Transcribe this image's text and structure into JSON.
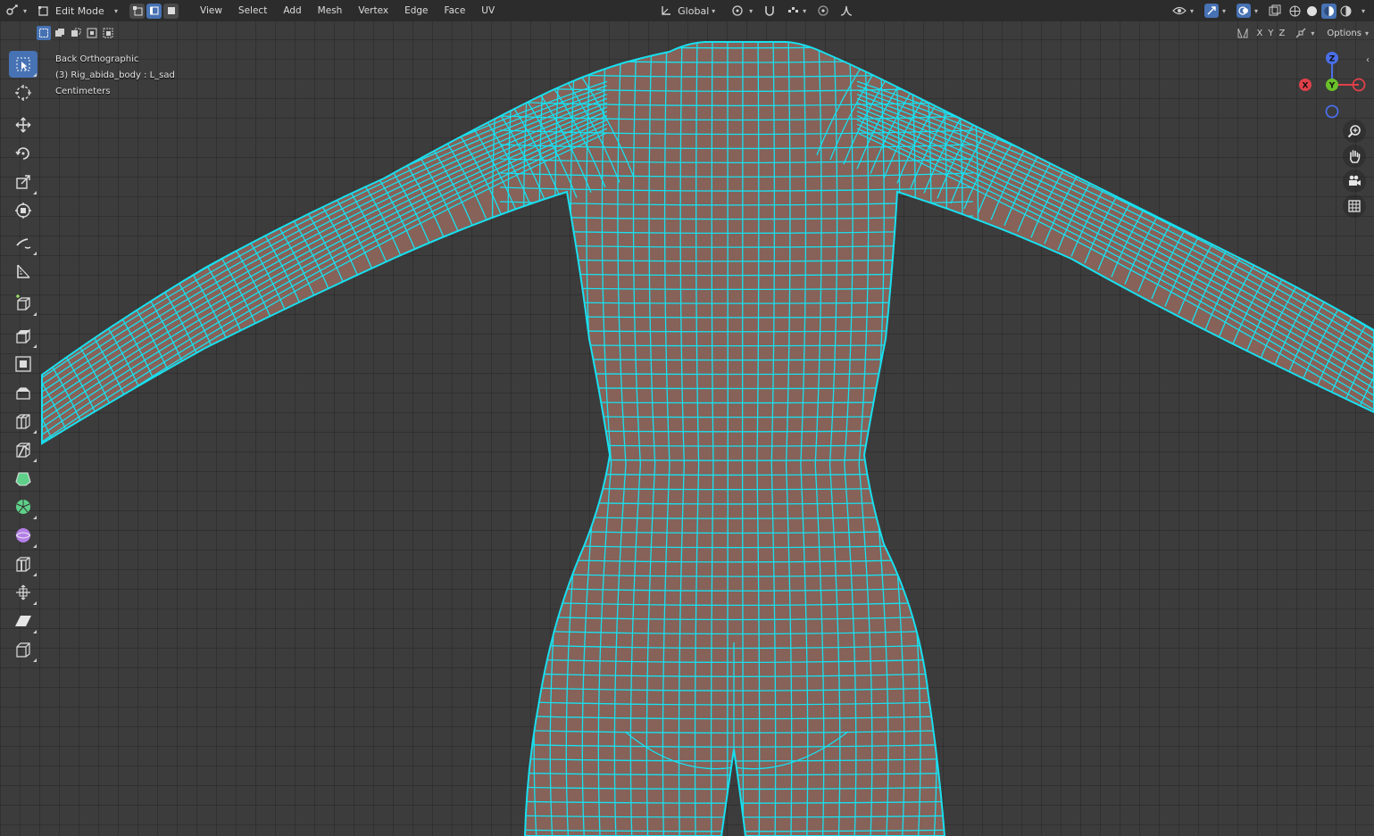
{
  "header": {
    "editor_type_icon": "editor-type-icon",
    "mode": "Edit Mode",
    "select_modes": [
      "vertex",
      "edge",
      "face"
    ],
    "active_select_mode": "edge",
    "menus": [
      "View",
      "Select",
      "Add",
      "Mesh",
      "Vertex",
      "Edge",
      "Face",
      "UV"
    ],
    "orientation": "Global",
    "right_icons": [
      "visibility-icon",
      "gizmo-icon",
      "overlay-icon",
      "xray-icon",
      "wireframe-shading-icon",
      "solid-shading-icon",
      "material-shading-icon",
      "render-shading-icon"
    ]
  },
  "subheader": {
    "selection_ops": [
      "set-selection",
      "extend-selection",
      "subtract-selection",
      "invert-selection",
      "intersect-selection"
    ],
    "mirror_axes": [
      "X",
      "Y",
      "Z"
    ],
    "options_label": "Options"
  },
  "viewport": {
    "view_name": "Back Orthographic",
    "object_info": "(3) Rig_abida_body : L_sad",
    "units": "Centimeters"
  },
  "toolbar": {
    "active_tool": "select-box",
    "tools": [
      "select-box",
      "cursor",
      "move",
      "rotate",
      "scale",
      "transform",
      "annotate",
      "measure",
      "add-cube",
      "extrude-region",
      "inset-faces",
      "bevel",
      "loop-cut",
      "knife",
      "poly-build",
      "spin",
      "smooth",
      "edge-slide",
      "shrink-fatten",
      "shear",
      "rip-region"
    ]
  },
  "gizmo": {
    "axes": [
      "Z",
      "Y",
      "X"
    ],
    "colors": {
      "x": "#e0404a",
      "y": "#6ac02a",
      "z": "#4a6ee8"
    }
  },
  "colors": {
    "wire": "#18e0f0",
    "skin": "#866258",
    "accent": "#4772b3",
    "grid_bg": "#3c3c3c"
  }
}
